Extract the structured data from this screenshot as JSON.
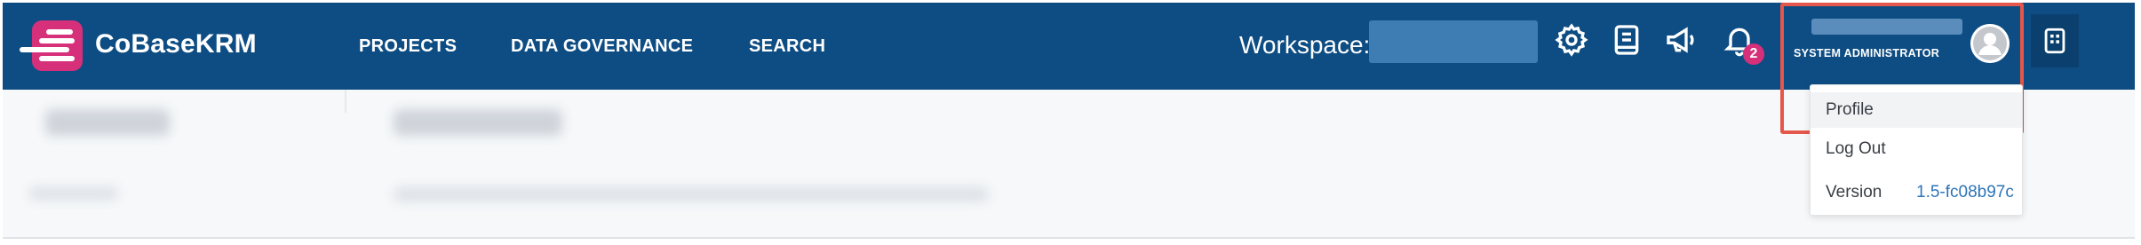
{
  "app": {
    "name": "CoBaseKRM"
  },
  "nav": {
    "links": [
      "PROJECTS",
      "DATA GOVERNANCE",
      "SEARCH"
    ]
  },
  "workspace": {
    "label": "Workspace:",
    "value": ""
  },
  "toolbar": {
    "icons": [
      "settings-icon",
      "book-icon",
      "megaphone-icon",
      "bell-icon",
      "apps-icon"
    ],
    "notification_count": "2"
  },
  "user": {
    "name": "",
    "role": "SYSTEM ADMINISTRATOR"
  },
  "dropdown": {
    "items": [
      "Profile",
      "Log Out"
    ],
    "version_label": "Version",
    "version_value": "1.5-fc08b97c"
  },
  "colors": {
    "navbar": "#0e4d83",
    "brand_accent": "#d6307a",
    "highlight": "#e4574a",
    "link": "#2d74b8"
  }
}
